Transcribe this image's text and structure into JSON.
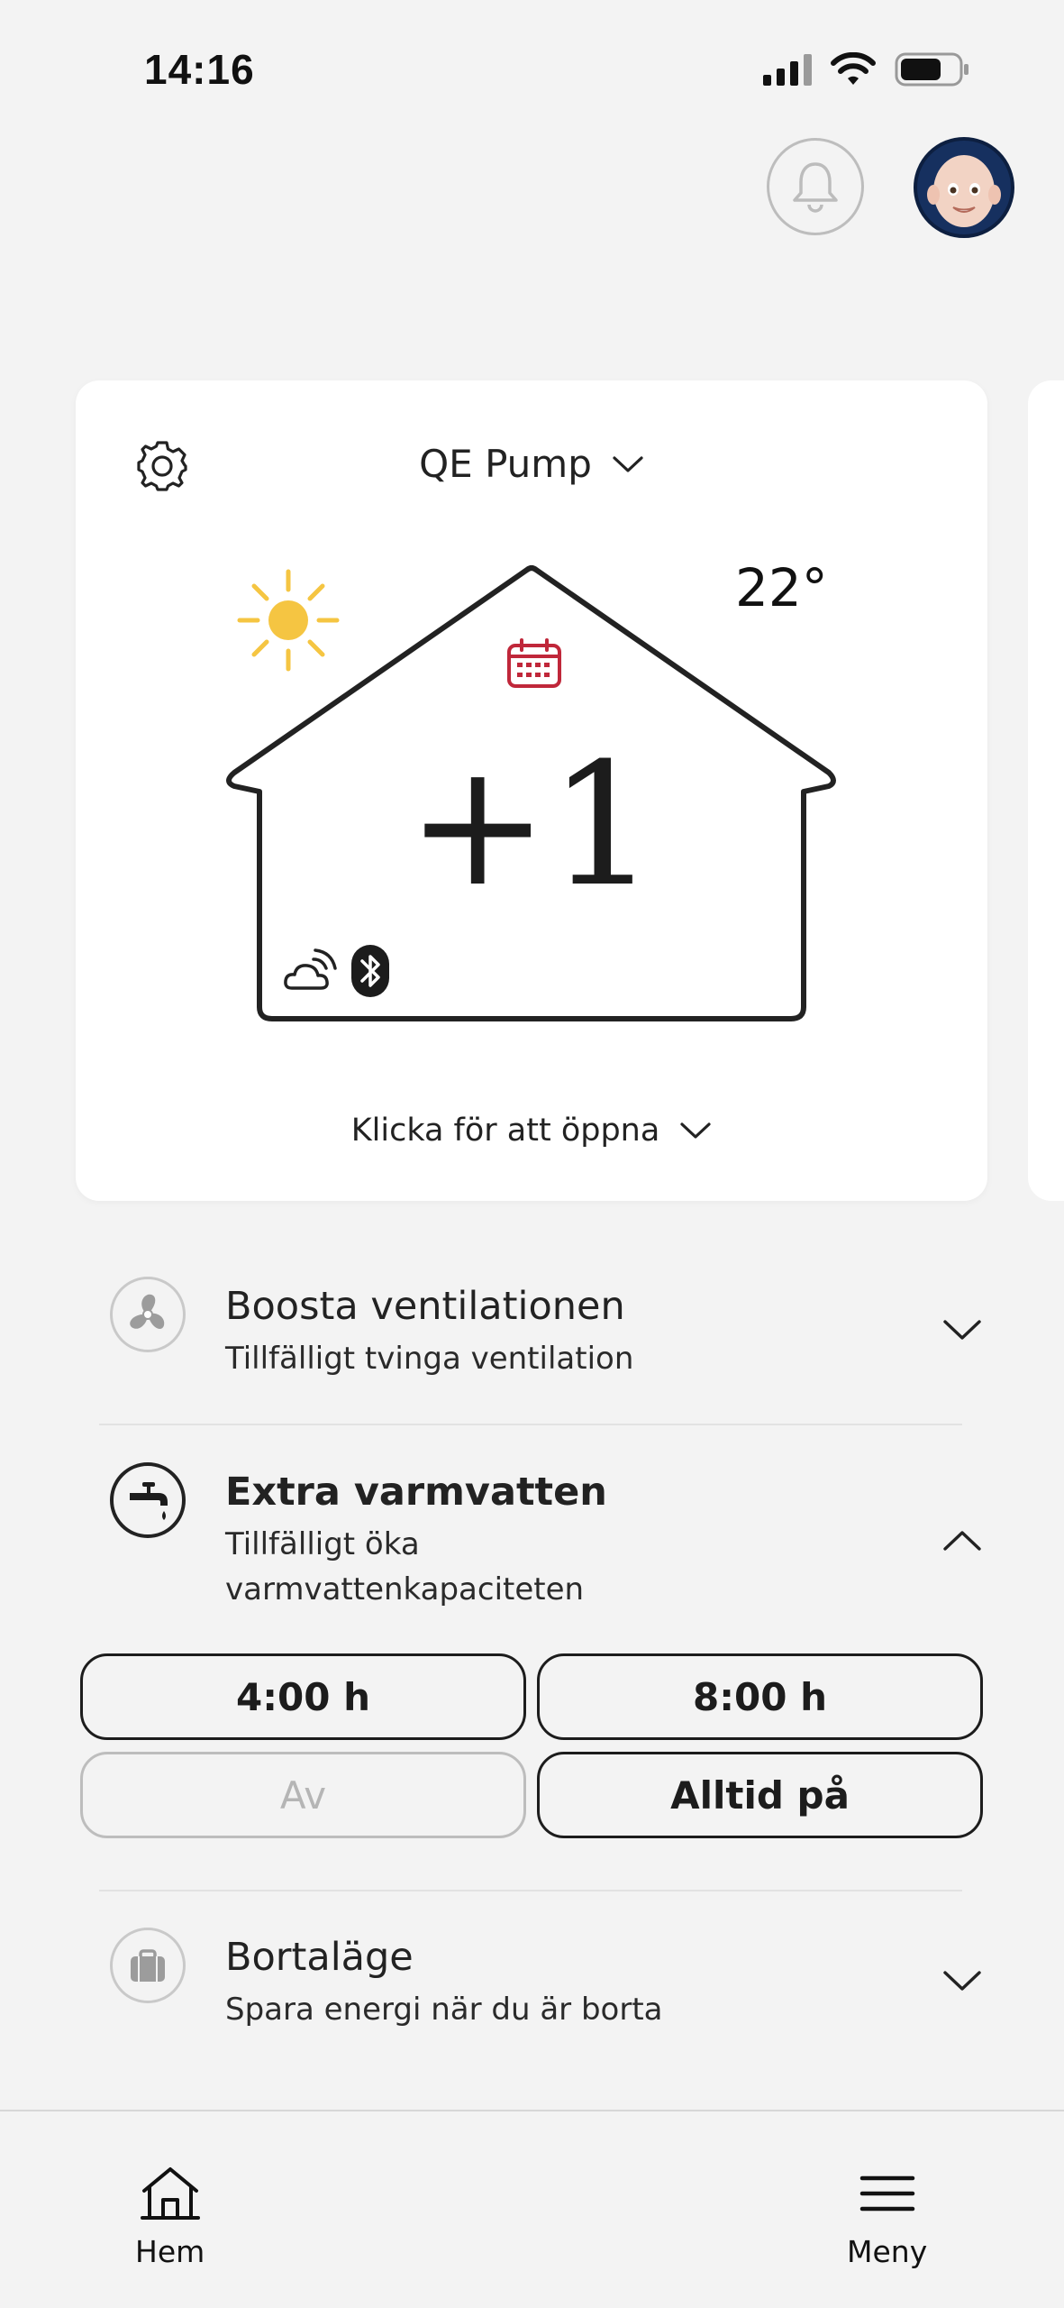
{
  "status_bar": {
    "time": "14:16"
  },
  "card": {
    "device_name": "QE Pump",
    "temperature": "22°",
    "offset": "+1",
    "open_label": "Klicka för att öppna"
  },
  "rows": [
    {
      "title": "Boosta ventilationen",
      "subtitle": "Tillfälligt tvinga ventilation",
      "icon": "fan-icon",
      "expanded": false
    },
    {
      "title": "Extra varmvatten",
      "subtitle_line1": "Tillfälligt öka",
      "subtitle_line2": "varmvattenkapaciteten",
      "icon": "faucet-icon",
      "expanded": true
    },
    {
      "title": "Bortaläge",
      "subtitle": "Spara energi när du är borta",
      "icon": "suitcase-icon",
      "expanded": false
    }
  ],
  "hot_water_options": [
    {
      "label": "4:00 h",
      "enabled": true
    },
    {
      "label": "8:00 h",
      "enabled": true
    },
    {
      "label": "Av",
      "enabled": false
    },
    {
      "label": "Alltid på",
      "enabled": true
    }
  ],
  "nav": {
    "home_label": "Hem",
    "menu_label": "Meny"
  },
  "colors": {
    "sun": "#f5c542",
    "calendar": "#c0273a",
    "background": "#f3f3f3",
    "card": "#ffffff"
  }
}
